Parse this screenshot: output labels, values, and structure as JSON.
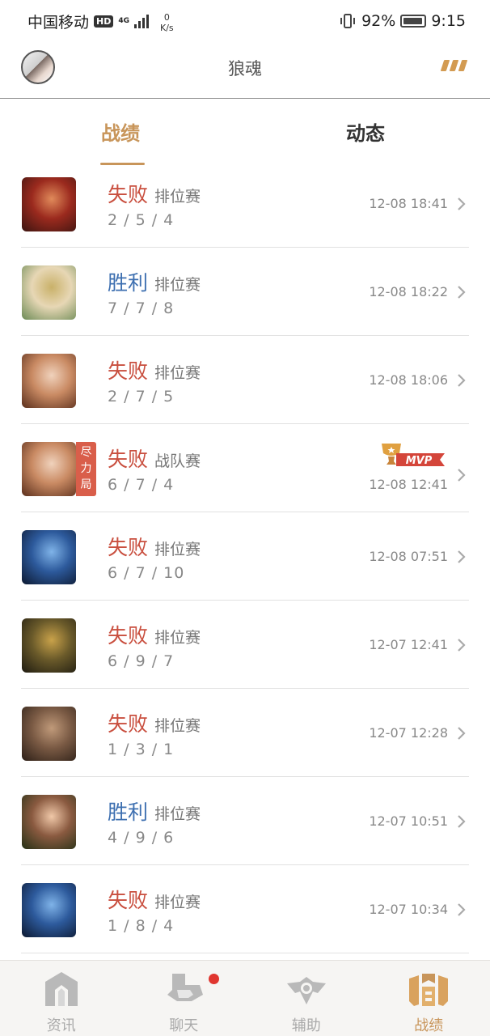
{
  "status_bar": {
    "carrier": "中国移动",
    "hd": "HD",
    "network": "4G",
    "speed_value": "0",
    "speed_unit": "K/s",
    "battery": "92%",
    "time": "9:15"
  },
  "header": {
    "title": "狼魂",
    "more_icon": "more-icon"
  },
  "tabs": [
    {
      "label": "战绩",
      "active": true
    },
    {
      "label": "动态",
      "active": false
    }
  ],
  "matches": [
    {
      "result": "失败",
      "mode": "排位赛",
      "kda": "2 / 5 / 4",
      "time": "12-08 18:41",
      "hero_colors": [
        "#3a1410",
        "#9b2a1e",
        "#e08a5a"
      ]
    },
    {
      "result": "胜利",
      "mode": "排位赛",
      "kda": "7 / 7 / 8",
      "time": "12-08 18:22",
      "hero_colors": [
        "#6b8a55",
        "#e7d7b5",
        "#c9b169"
      ]
    },
    {
      "result": "失败",
      "mode": "排位赛",
      "kda": "2 / 7 / 5",
      "time": "12-08 18:06",
      "hero_colors": [
        "#5a2e1b",
        "#c98a63",
        "#f0d2bc"
      ]
    },
    {
      "result": "失败",
      "mode": "战队赛",
      "kda": "6 / 7 / 4",
      "time": "12-08 12:41",
      "hero_colors": [
        "#5a2e1b",
        "#c98a63",
        "#f0d2bc"
      ],
      "tag": "尽力局",
      "mvp": "MVP"
    },
    {
      "result": "失败",
      "mode": "排位赛",
      "kda": "6 / 7 / 10",
      "time": "12-08 07:51",
      "hero_colors": [
        "#0c1830",
        "#2d5a9c",
        "#7fb3e8"
      ]
    },
    {
      "result": "失败",
      "mode": "排位赛",
      "kda": "6 / 9 / 7",
      "time": "12-07 12:41",
      "hero_colors": [
        "#1d1a10",
        "#6a5a2a",
        "#c9a24a"
      ]
    },
    {
      "result": "失败",
      "mode": "排位赛",
      "kda": "1 / 3 / 1",
      "time": "12-07 12:28",
      "hero_colors": [
        "#2b1e16",
        "#7a5a44",
        "#c09a7a"
      ]
    },
    {
      "result": "胜利",
      "mode": "排位赛",
      "kda": "4 / 9 / 6",
      "time": "12-07 10:51",
      "hero_colors": [
        "#243015",
        "#8a5a40",
        "#f0c8a8"
      ]
    },
    {
      "result": "失败",
      "mode": "排位赛",
      "kda": "1 / 8 / 4",
      "time": "12-07 10:34",
      "hero_colors": [
        "#0c1830",
        "#2d5a9c",
        "#7fb3e8"
      ]
    }
  ],
  "bottom_nav": [
    {
      "label": "资讯",
      "icon": "news-icon"
    },
    {
      "label": "聊天",
      "icon": "chat-icon",
      "badge": true
    },
    {
      "label": "辅助",
      "icon": "assist-icon"
    },
    {
      "label": "战绩",
      "icon": "record-icon",
      "active": true
    }
  ],
  "colors": {
    "accent": "#c8955a",
    "lose": "#c94f3f",
    "win": "#3d6fb0",
    "badge": "#e0362f"
  }
}
